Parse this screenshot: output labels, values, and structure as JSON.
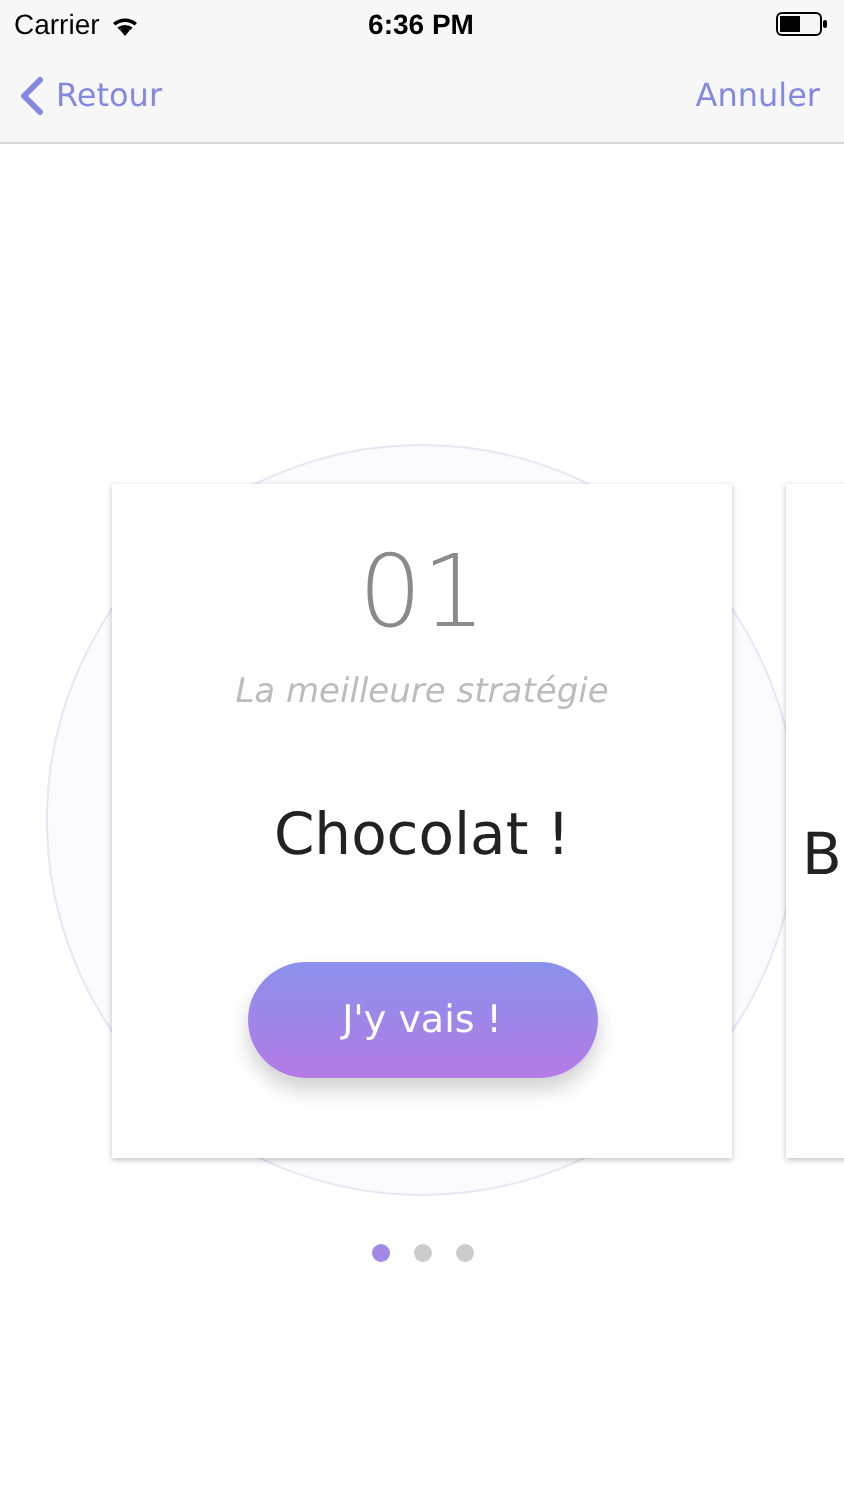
{
  "status_bar": {
    "carrier": "Carrier",
    "time": "6:36 PM"
  },
  "nav": {
    "back": "Retour",
    "cancel": "Annuler"
  },
  "cards": [
    {
      "number": "01",
      "subtitle": "La meilleure stratégie",
      "title": "Chocolat !",
      "button": "J'y vais !"
    },
    {
      "title": "B"
    }
  ],
  "dots": [
    {
      "selected": true
    },
    {
      "selected": false
    },
    {
      "selected": false
    }
  ]
}
